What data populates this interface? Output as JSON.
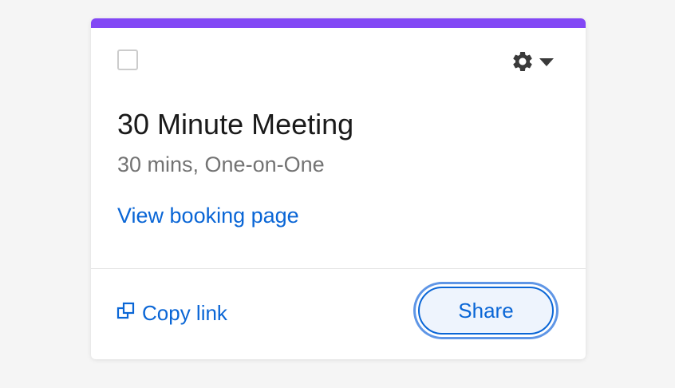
{
  "card": {
    "accent_color": "#8247f5",
    "title": "30 Minute Meeting",
    "subtitle": "30 mins, One-on-One",
    "booking_link": "View booking page",
    "settings_icon": "gear-icon",
    "settings_dropdown_icon": "caret-down-icon",
    "select_checked": false
  },
  "footer": {
    "copy_link_label": "Copy link",
    "copy_link_icon": "copy-icon",
    "share_label": "Share"
  },
  "colors": {
    "link": "#0a66d6",
    "title": "#1a1a1a",
    "subtitle": "#737373"
  }
}
